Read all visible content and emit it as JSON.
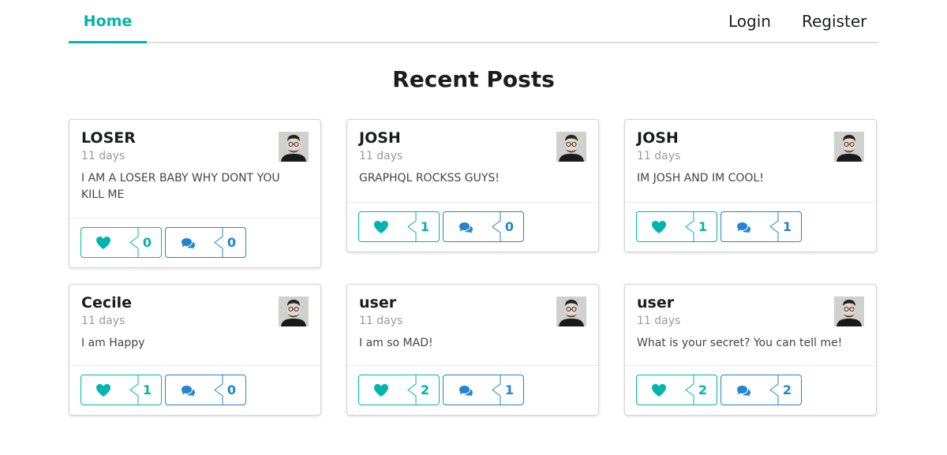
{
  "nav": {
    "home": "Home",
    "login": "Login",
    "register": "Register"
  },
  "page": {
    "title": "Recent Posts"
  },
  "colors": {
    "accent": "#00b5ad",
    "comment": "#2185d0"
  },
  "posts": [
    {
      "username": "LOSER",
      "date": "11 days",
      "body": "I AM A LOSER BABY WHY DONT YOU KILL ME",
      "likes": "0",
      "comments": "0"
    },
    {
      "username": "JOSH",
      "date": "11 days",
      "body": "GRAPHQL ROCKSS GUYS!",
      "likes": "1",
      "comments": "0"
    },
    {
      "username": "JOSH",
      "date": "11 days",
      "body": "IM JOSH AND IM COOL!",
      "likes": "1",
      "comments": "1"
    },
    {
      "username": "Cecile",
      "date": "11 days",
      "body": "I am Happy",
      "likes": "1",
      "comments": "0"
    },
    {
      "username": "user",
      "date": "11 days",
      "body": "I am so MAD!",
      "likes": "2",
      "comments": "1"
    },
    {
      "username": "user",
      "date": "11 days",
      "body": "What is your secret? You can tell me!",
      "likes": "2",
      "comments": "2"
    }
  ],
  "icons": {
    "like": "heart-icon",
    "comment": "comments-icon",
    "avatar": "avatar-image"
  }
}
